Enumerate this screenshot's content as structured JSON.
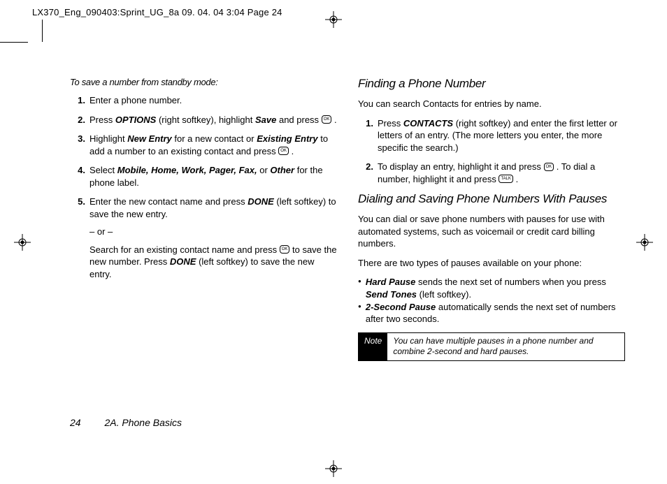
{
  "header": "LX370_Eng_090403:Sprint_UG_8a  09. 04. 04      3:04   Page 24",
  "left": {
    "intro": "To save a number from standby mode:",
    "s1": "Enter a phone number.",
    "s2a": "Press ",
    "s2_opt": "OPTIONS",
    "s2b": " (right softkey), highlight ",
    "s2_save": "Save",
    "s2c": " and press ",
    "s2d": " .",
    "s3a": "Highlight ",
    "s3_new": "New Entry",
    "s3b": " for a new contact or ",
    "s3_ex": "Existing Entry",
    "s3c": " to add a number to an existing contact and press ",
    "s3d": " .",
    "s4a": "Select ",
    "s4_lab": "Mobile, Home, Work, Pager, Fax,",
    "s4b": " or ",
    "s4_oth": "Other",
    "s4c": " for the phone label.",
    "s5a": "Enter the new contact name and press  ",
    "s5_done": "DONE",
    "s5b": " (left softkey) to save the new entry.",
    "or": "– or –",
    "s5c": "Search for an existing contact name and press ",
    "s5d": " to save the new number. Press ",
    "s5_done2": "DONE",
    "s5e": " (left softkey) to save the new entry."
  },
  "right": {
    "h1": "Finding a Phone Number",
    "p1": "You can search Contacts for entries by name.",
    "r1a": "Press ",
    "r1_con": "CONTACTS",
    "r1b": " (right softkey) and enter the first letter or letters of an entry. (The more letters you enter, the more specific the search.)",
    "r2a": "To display an entry, highlight it and press ",
    "r2b": " . To dial a number, highlight it and press ",
    "r2c": " .",
    "h2": "Dialing and Saving Phone Numbers With Pauses",
    "p2": "You can dial or save phone numbers with pauses for use with automated systems, such as voicemail or credit card billing numbers.",
    "p3": "There are two types of pauses available on your phone:",
    "b1_hp": "Hard Pause",
    "b1a": " sends the next set of numbers when you press ",
    "b1_st": "Send Tones",
    "b1b": " (left softkey).",
    "b2_sp": "2-Second Pause",
    "b2a": " automatically sends the next set of numbers after two seconds.",
    "note_label": "Note",
    "note_text": "You can have multiple pauses in a phone number and combine 2-second and hard pauses."
  },
  "footer": {
    "page": "24",
    "section": "2A. Phone Basics"
  },
  "icons": {
    "ok": "OK",
    "talk": "TALK"
  }
}
